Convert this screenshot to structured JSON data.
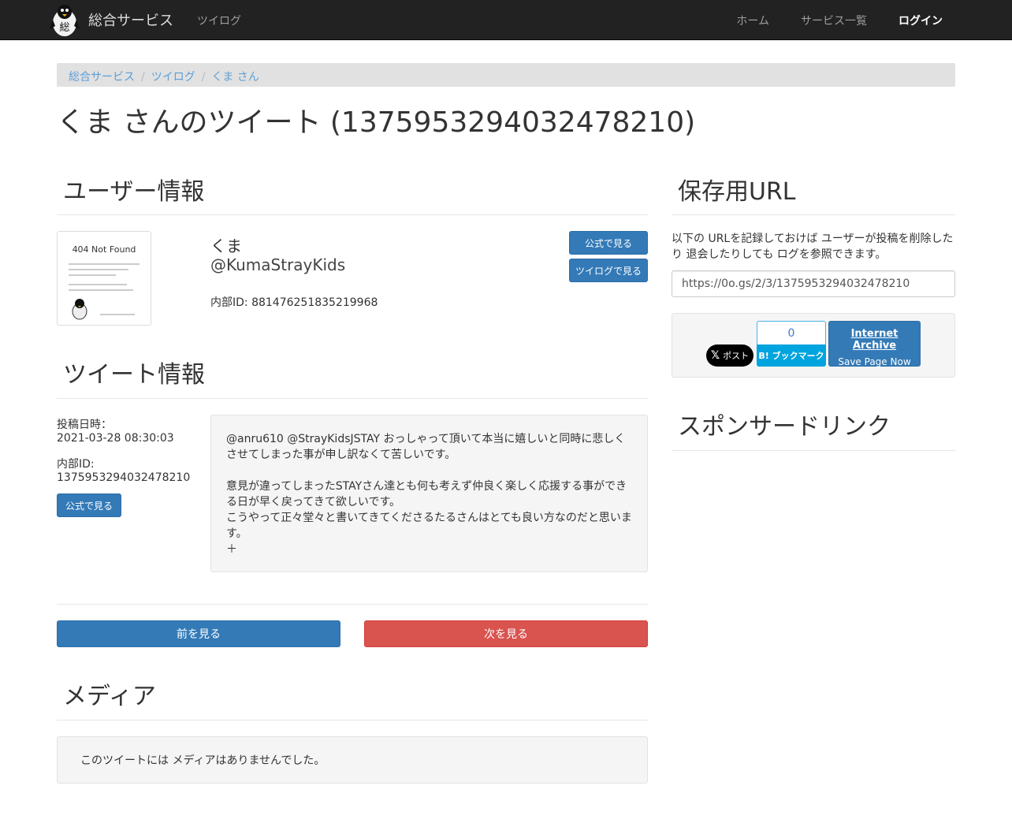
{
  "navbar": {
    "brand": "総合サービス",
    "brand_logo_char": "総",
    "left_item": "ツイログ",
    "right_items": [
      "ホーム",
      "サービス一覧",
      "ログイン"
    ]
  },
  "breadcrumb": [
    "総合サービス",
    "ツイログ",
    "くま さん"
  ],
  "page_title": "くま さんのツイート (1375953294032478210)",
  "user_section": {
    "heading": "ユーザー情報",
    "avatar_text": "404 Not Found",
    "name": "くま",
    "handle": "@KumaStrayKids",
    "internal_id": "内部ID: 881476251835219968",
    "official_button": "公式で見る",
    "tweelog_button": "ツイログで見る"
  },
  "tweet_section": {
    "heading": "ツイート情報",
    "posted_label": "投稿日時：",
    "posted_value": "2021-03-28 08:30:03",
    "id_label": "内部ID:",
    "id_value": "1375953294032478210",
    "official_button": "公式で見る",
    "text": "@anru610 @StrayKidsJSTAY おっしゃって頂いて本当に嬉しいと同時に悲しくさせてしまった事が申し訳なくて苦しいです。\n\n意見が違ってしまったSTAYさん達とも何も考えず仲良く楽しく応援する事ができる日が早く戻ってきて欲しいです。\nこうやって正々堂々と書いてきてくださるたるさんはとても良い方なのだと思います。\n＋"
  },
  "pager": {
    "prev": "前を見る",
    "next": "次を見る"
  },
  "media_section": {
    "heading": "メディア",
    "empty_message": "このツイートには メディアはありませんでした。"
  },
  "save_section": {
    "heading": "保存用URL",
    "description": "以下の URLを記録しておけば ユーザーが投稿を削除したり 退会したりしても ログを参照できます。",
    "url": "https://0o.gs/2/3/1375953294032478210",
    "x_button": "ポスト",
    "hatena_count": "0",
    "hatena_button": "B! ブックマーク",
    "ia_title": "Internet Archive",
    "ia_sub": "Save Page Now"
  },
  "sponsor_section": {
    "heading": "スポンサードリンク"
  },
  "colors": {
    "navbar": "#222222",
    "primary": "#337ab7",
    "danger": "#d9534f",
    "hatena": "#00a4de"
  }
}
